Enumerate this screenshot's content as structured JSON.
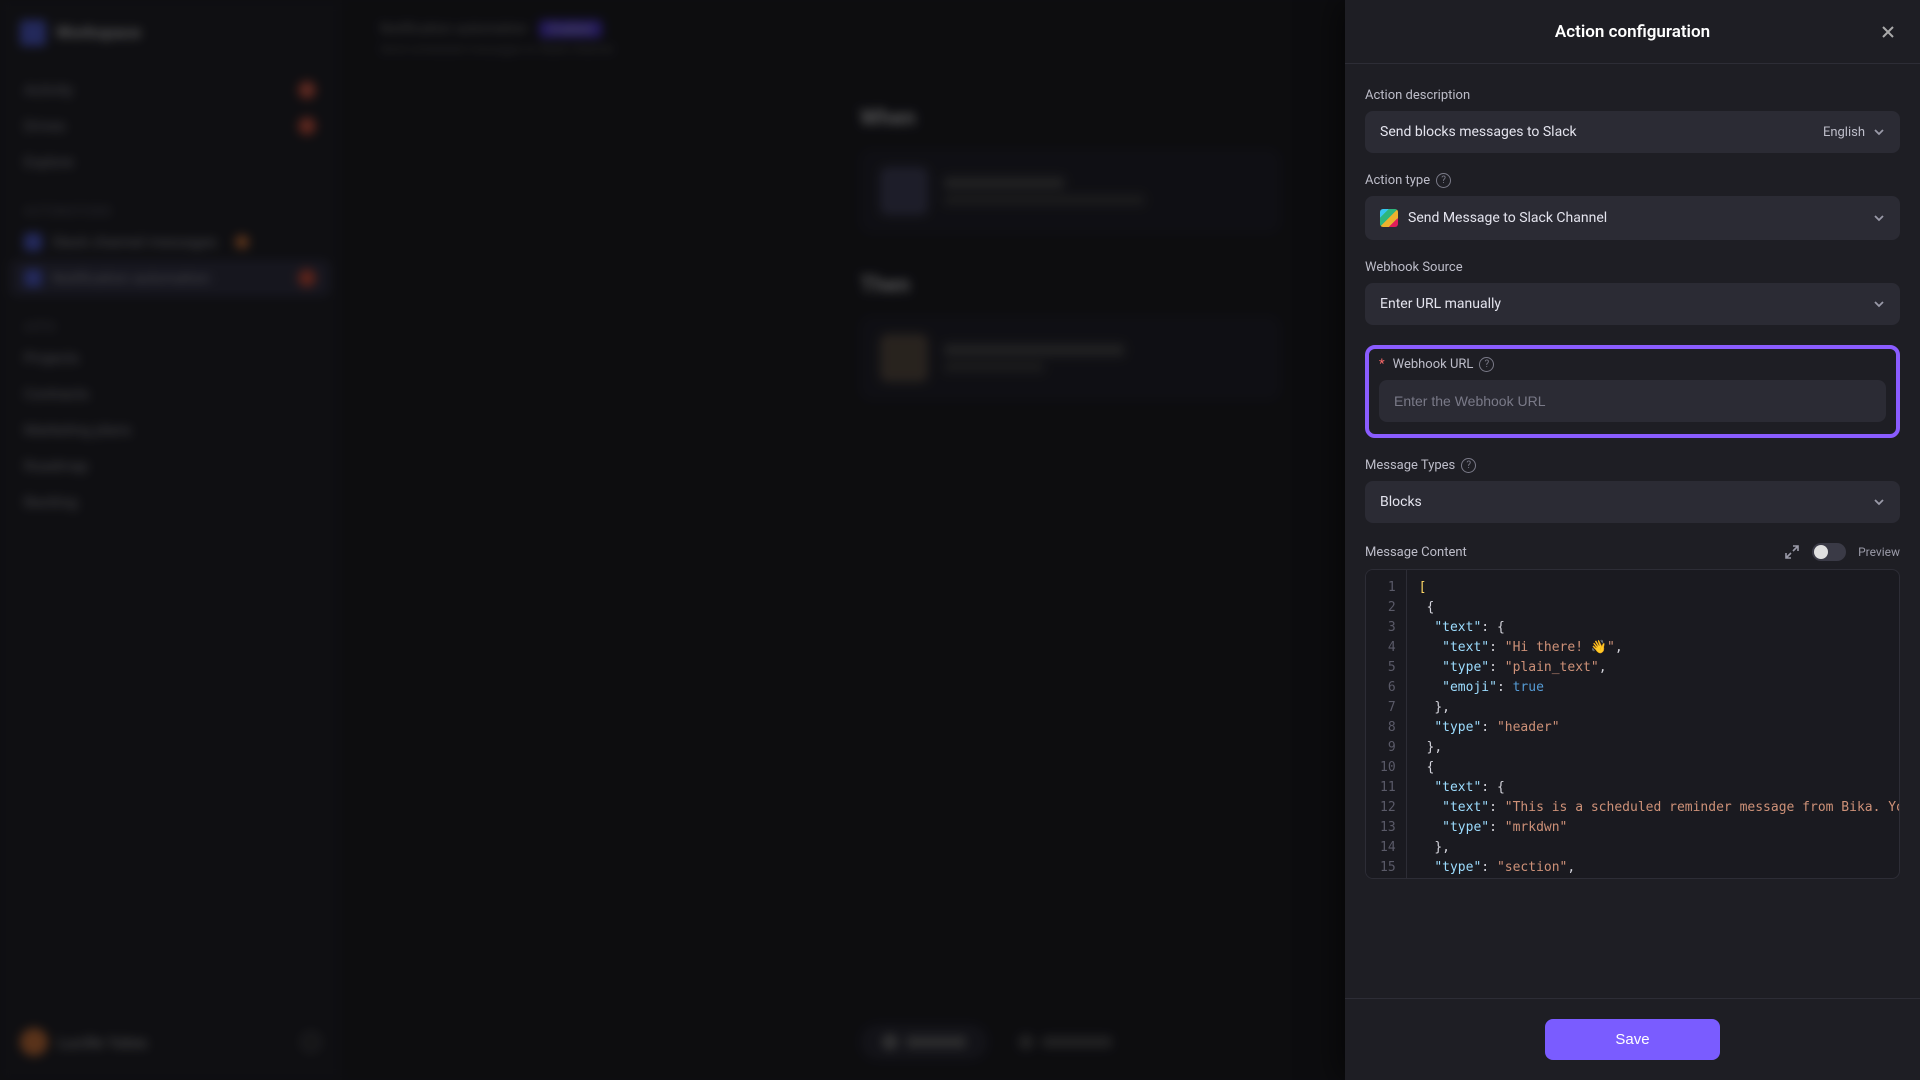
{
  "sidebar": {
    "workspace": "Workspace",
    "nav": [
      "Activity",
      "Drives",
      "Explore"
    ],
    "section_automations": "AUTOMATIONS",
    "automations": [
      "Slack channel messages",
      "Notification automation"
    ],
    "section_apps": "APPS",
    "apps": [
      "Projects",
      "Contracts",
      "Marketing plans",
      "Roadmap",
      "Backlog"
    ],
    "user": "Lucille Yates"
  },
  "main": {
    "breadcrumb": "Notification automation",
    "breadcrumb_tag": "Enabled",
    "breadcrumb_sub": "Send scheduled messages to Slack channel",
    "when_heading": "When",
    "then_heading": "Then",
    "run_now": "Run now",
    "history": "History"
  },
  "panel": {
    "title": "Action configuration",
    "labels": {
      "action_description": "Action description",
      "action_type": "Action type",
      "webhook_source": "Webhook Source",
      "webhook_url": "Webhook URL",
      "message_types": "Message Types",
      "message_content": "Message Content",
      "preview": "Preview"
    },
    "values": {
      "action_description": "Send blocks messages to Slack",
      "language": "English",
      "action_type": "Send Message to Slack Channel",
      "webhook_source": "Enter URL manually",
      "webhook_url": "",
      "webhook_url_placeholder": "Enter the Webhook URL",
      "message_types": "Blocks"
    },
    "code_lines": [
      "[",
      " {",
      "  \"text\": {",
      "   \"text\": \"Hi there! 👋\",",
      "   \"type\": \"plain_text\",",
      "   \"emoji\": true",
      "  },",
      "  \"type\": \"header\"",
      " },",
      " {",
      "  \"text\": {",
      "   \"text\": \"This is a scheduled reminder message from Bika. You",
      "   \"type\": \"mrkdwn\"",
      "  },",
      "  \"type\": \"section\","
    ],
    "save": "Save"
  }
}
